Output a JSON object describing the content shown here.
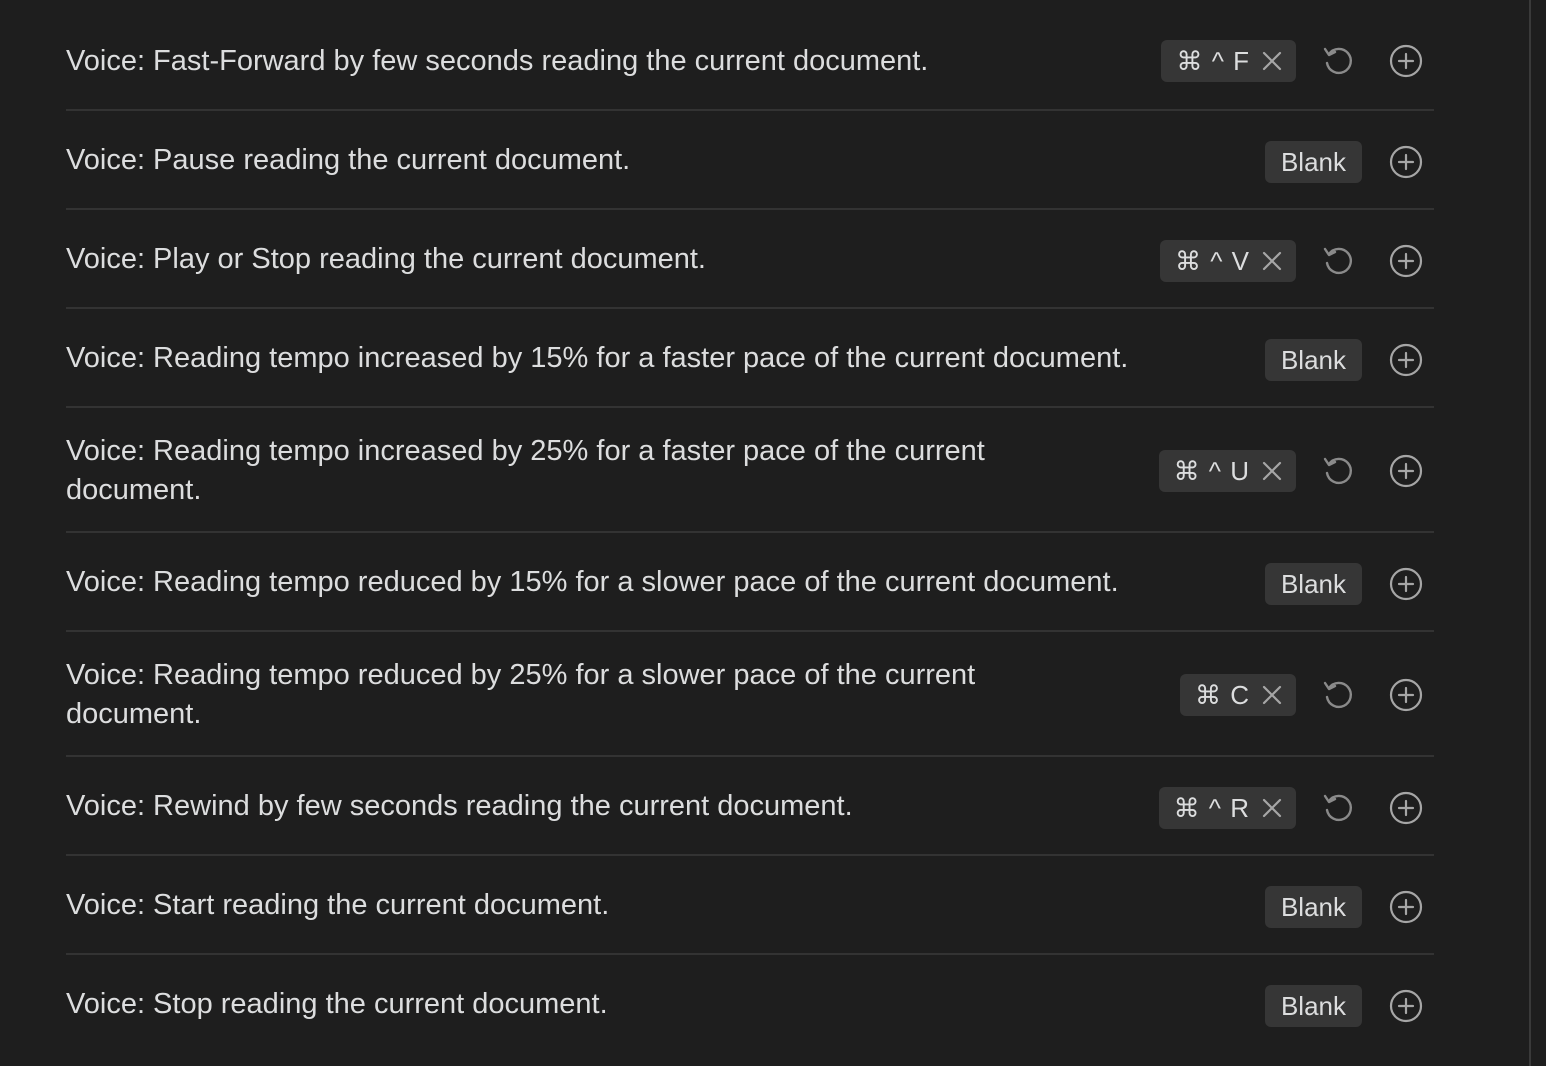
{
  "hotkeys": [
    {
      "label": "Voice: Fast-Forward by few seconds reading the current document.",
      "assigned": true,
      "keys": "⌘ ^ F"
    },
    {
      "label": "Voice: Pause reading the current document.",
      "assigned": false,
      "blank": "Blank"
    },
    {
      "label": "Voice: Play or Stop reading the current document.",
      "assigned": true,
      "keys": "⌘ ^ V"
    },
    {
      "label": "Voice: Reading tempo increased by 15% for a faster pace of the current document.",
      "assigned": false,
      "blank": "Blank"
    },
    {
      "label": "Voice: Reading tempo increased by 25% for a faster pace of the current document.",
      "assigned": true,
      "keys": "⌘ ^ U"
    },
    {
      "label": "Voice: Reading tempo reduced by 15% for a slower pace of the current document.",
      "assigned": false,
      "blank": "Blank"
    },
    {
      "label": "Voice: Reading tempo reduced by 25% for a slower pace of the current document.",
      "assigned": true,
      "keys": "⌘ C"
    },
    {
      "label": "Voice: Rewind by few seconds reading the current document.",
      "assigned": true,
      "keys": "⌘ ^ R"
    },
    {
      "label": "Voice: Start reading the current document.",
      "assigned": false,
      "blank": "Blank"
    },
    {
      "label": "Voice: Stop reading the current document.",
      "assigned": false,
      "blank": "Blank"
    }
  ],
  "icons": {
    "remove": "x-icon",
    "reset": "reset-icon",
    "add": "plus-circle-icon"
  },
  "colors": {
    "background": "#1e1e1e",
    "badge": "#363636",
    "text": "#dcddde",
    "divider": "#333333"
  }
}
